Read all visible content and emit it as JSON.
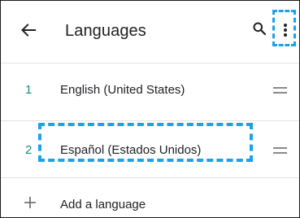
{
  "appbar": {
    "title": "Languages",
    "back_icon": "arrow-left-icon",
    "search_icon": "search-icon",
    "more_icon": "more-vert-icon"
  },
  "languages": [
    {
      "number": "1",
      "label": "English (United States)"
    },
    {
      "number": "2",
      "label": "Español (Estados Unidos)"
    }
  ],
  "add_language": {
    "label": "Add a language",
    "icon": "plus-icon"
  },
  "colors": {
    "accent_number": "#1a8a78",
    "highlight": "#1aa3e8",
    "divider": "#e3e3e3"
  }
}
